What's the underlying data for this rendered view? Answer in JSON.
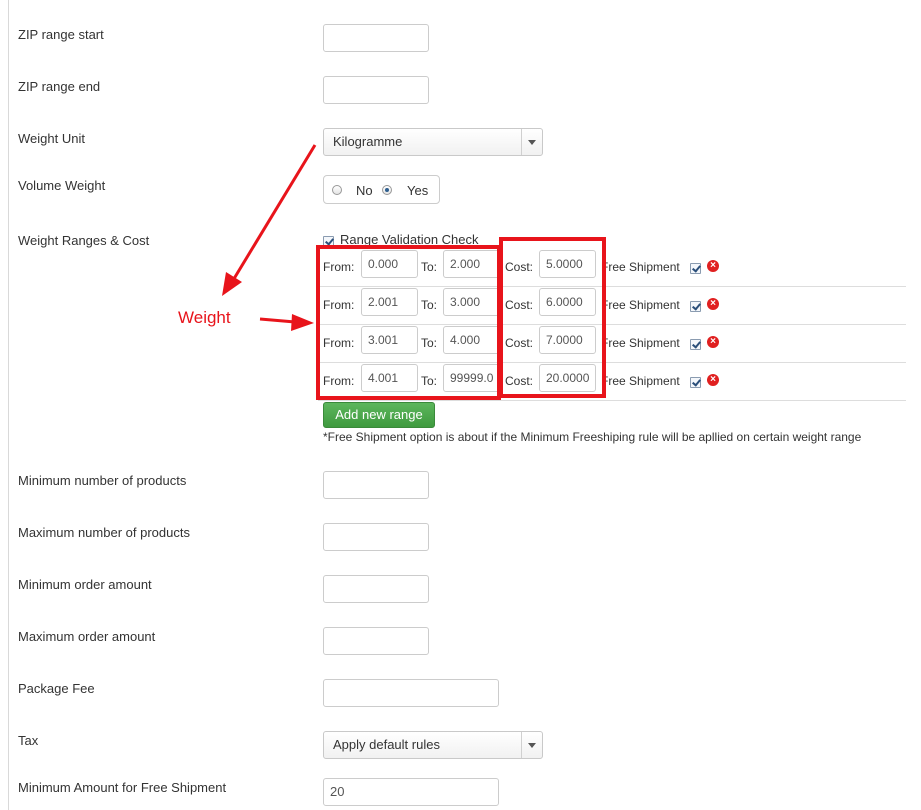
{
  "fields": {
    "zip_start": {
      "label": "ZIP range start",
      "value": ""
    },
    "zip_end": {
      "label": "ZIP range end",
      "value": ""
    },
    "weight_unit": {
      "label": "Weight Unit",
      "selected": "Kilogramme"
    },
    "volume_weight": {
      "label": "Volume Weight",
      "options": [
        "No",
        "Yes"
      ],
      "selected": "Yes"
    },
    "weight_ranges": {
      "label": "Weight Ranges & Cost",
      "validation_label": "Range Validation Check",
      "validation_checked": true,
      "from_label": "From:",
      "to_label": "To:",
      "cost_label": "Cost:",
      "free_label": "Free Shipment",
      "rows": [
        {
          "from": "0.000",
          "to": "2.000",
          "cost": "5.0000",
          "free": true
        },
        {
          "from": "2.001",
          "to": "3.000",
          "cost": "6.0000",
          "free": true
        },
        {
          "from": "3.001",
          "to": "4.000",
          "cost": "7.0000",
          "free": true
        },
        {
          "from": "4.001",
          "to": "99999.0",
          "cost": "20.0000",
          "free": true
        }
      ],
      "add_button": "Add new range",
      "note": "*Free Shipment option is about if the Minimum Freeshiping rule will be apllied on certain weight range"
    },
    "min_products": {
      "label": "Minimum number of products",
      "value": ""
    },
    "max_products": {
      "label": "Maximum number of products",
      "value": ""
    },
    "min_order": {
      "label": "Minimum order amount",
      "value": ""
    },
    "max_order": {
      "label": "Maximum order amount",
      "value": ""
    },
    "package_fee": {
      "label": "Package Fee",
      "value": ""
    },
    "tax": {
      "label": "Tax",
      "selected": "Apply default rules"
    },
    "min_free": {
      "label": "Minimum Amount for Free Shipment",
      "value": "20"
    }
  },
  "annotation": {
    "text": "Weight",
    "color": "#e8141b"
  },
  "colors": {
    "accent_green": "#4aa84a",
    "highlight_red": "#e8141b"
  }
}
